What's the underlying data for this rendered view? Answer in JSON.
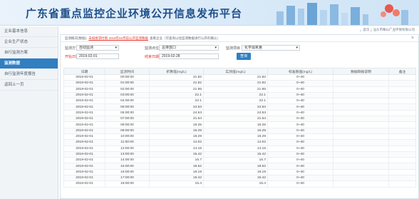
{
  "banner": {
    "title": "广东省重点监控企业环境公开信息发布平台"
  },
  "sidebar": {
    "items": [
      {
        "label": "企业基本信息",
        "active": false
      },
      {
        "label": "企业生产状态",
        "active": false
      },
      {
        "label": "自行监测方案",
        "active": false
      },
      {
        "label": "监测数据",
        "active": true
      },
      {
        "label": "自行监测年度报告",
        "active": false
      },
      {
        "label": "返回上一页",
        "active": false
      }
    ]
  },
  "breadcrumb": {
    "items": [
      "首页",
      "汕头市精山广业环保有限公司"
    ]
  },
  "panel": {
    "prefix": "监测概况(数据):",
    "warning": "未按要求时限 2019年02月前公开监测数据",
    "suffix": "查看企业（可查询以往监测数据进行公开的确认）",
    "close": "×"
  },
  "filters": {
    "method_label": "监测方式",
    "method_value": "自动监测",
    "point_label": "监测点位",
    "point_value": "总排放口",
    "item_label": "监测项目",
    "item_value": "化学需氧量",
    "start_label": "开始日期",
    "start_value": "2019-02-01",
    "end_label": "结束日期",
    "end_value": "2019-02-28",
    "query_button": "查询"
  },
  "table": {
    "headers": [
      "日期",
      "监测时间",
      "折算值(mg/L)",
      "实测值(mg/L)",
      "标准限值(mg/L)",
      "数据缺报说明",
      "备注"
    ],
    "rows": [
      [
        "2019-02-01",
        "00:00:00",
        "21.82",
        "21.82",
        "0~40",
        "",
        ""
      ],
      [
        "2019-02-01",
        "01:00:00",
        "21.82",
        "21.82",
        "0~40",
        "",
        ""
      ],
      [
        "2019-02-01",
        "02:00:00",
        "21.95",
        "21.95",
        "0~40",
        "",
        ""
      ],
      [
        "2019-02-01",
        "03:00:00",
        "22.1",
        "22.1",
        "0~40",
        "",
        ""
      ],
      [
        "2019-02-01",
        "04:00:00",
        "22.1",
        "22.1",
        "0~40",
        "",
        ""
      ],
      [
        "2019-02-01",
        "05:00:00",
        "24.53",
        "24.53",
        "0~40",
        "",
        ""
      ],
      [
        "2019-02-01",
        "06:00:00",
        "24.53",
        "24.53",
        "0~40",
        "",
        ""
      ],
      [
        "2019-02-01",
        "07:00:00",
        "21.54",
        "21.54",
        "0~40",
        "",
        ""
      ],
      [
        "2019-02-01",
        "08:00:00",
        "16.25",
        "16.25",
        "0~40",
        "",
        ""
      ],
      [
        "2019-02-01",
        "09:00:00",
        "16.29",
        "16.29",
        "0~40",
        "",
        ""
      ],
      [
        "2019-02-01",
        "10:00:00",
        "16.29",
        "16.29",
        "0~40",
        "",
        ""
      ],
      [
        "2019-02-01",
        "11:00:00",
        "14.02",
        "14.02",
        "0~40",
        "",
        ""
      ],
      [
        "2019-02-01",
        "12:00:00",
        "14.15",
        "14.15",
        "0~40",
        "",
        ""
      ],
      [
        "2019-02-01",
        "13:00:00",
        "15.42",
        "15.42",
        "0~40",
        "",
        ""
      ],
      [
        "2019-02-01",
        "14:00:00",
        "16.7",
        "16.7",
        "0~40",
        "",
        ""
      ],
      [
        "2019-02-01",
        "15:00:00",
        "18.52",
        "18.52",
        "0~40",
        "",
        ""
      ],
      [
        "2019-02-01",
        "16:00:00",
        "18.19",
        "18.19",
        "0~40",
        "",
        ""
      ],
      [
        "2019-02-01",
        "17:00:00",
        "15.42",
        "15.42",
        "0~40",
        "",
        ""
      ],
      [
        "2019-02-01",
        "18:00:00",
        "15.4",
        "15.4",
        "0~40",
        "",
        ""
      ]
    ]
  },
  "colors": {
    "accent": "#2f7fc1",
    "warning": "#e2362d"
  }
}
